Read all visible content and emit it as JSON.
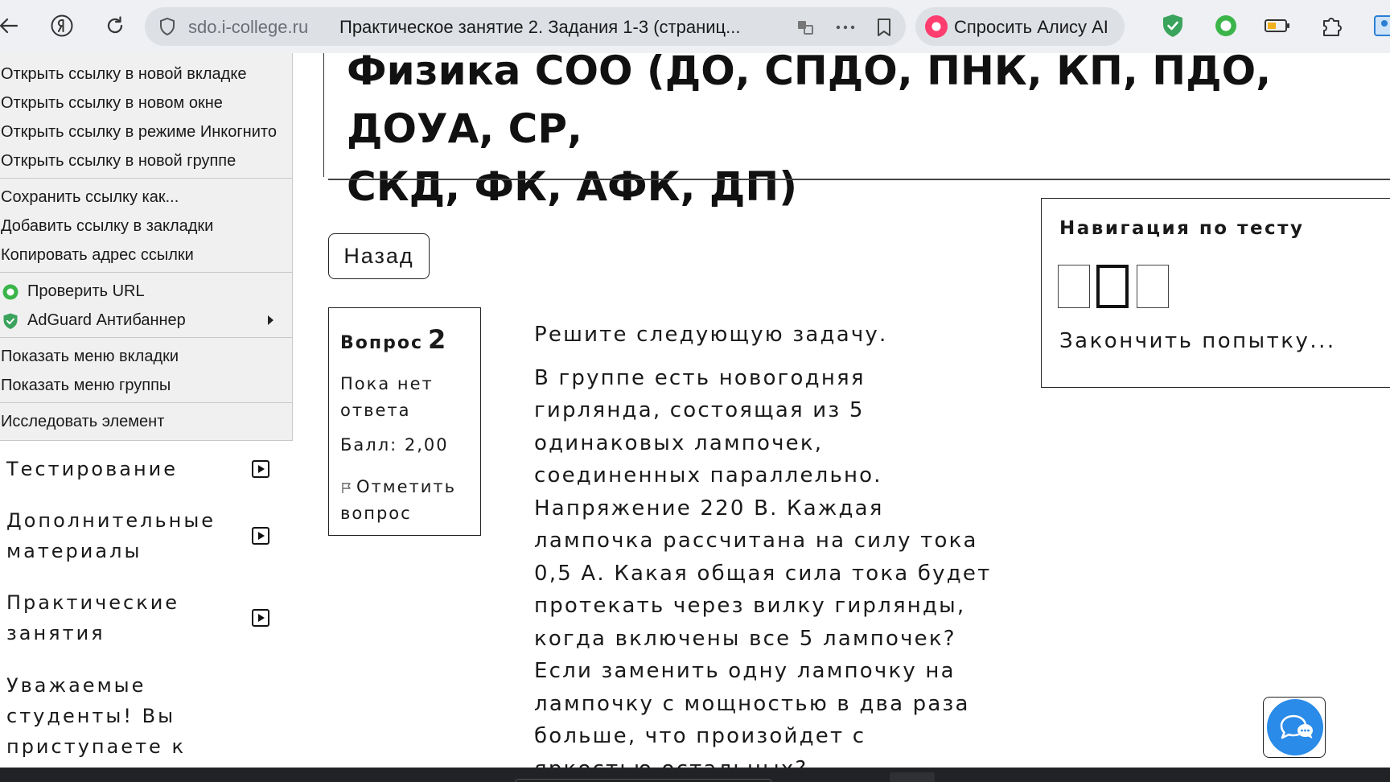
{
  "browser": {
    "domain": "sdo.i-college.ru",
    "tab_title": "Практическое занятие 2. Задания 1-3 (страниц...",
    "alice_label": "Спросить Алису AI"
  },
  "page": {
    "course_title": "Физика СОО (ДО, СПДО, ПНК, КП, ПДО, ДОУА, СР,\nСКД, ФК, АФК, ДП)",
    "back_label": "Назад"
  },
  "question_info": {
    "label": "Вопрос",
    "number": "2",
    "status": "Пока нет ответа",
    "score": "Балл: 2,00",
    "flag_label": "Отметить вопрос"
  },
  "question": {
    "intro": "Решите следующую задачу.",
    "text": "В группе есть новогодняя гирлянда, состоящая из 5 одинаковых лампочек, соединенных параллельно. Напряжение 220 В. Каждая лампочка рассчитана на силу тока 0,5 А. Какая общая сила тока будет протекать через вилку гирлянды, когда включены все 5 лампочек? Если  заменить одну лампочку на лампочку с мощностью в два раза больше, что произойдет с яркостью остальных?"
  },
  "quiz_nav": {
    "title": "Навигация по тесту",
    "current_index": 2,
    "finish_label": "Закончить попытку..."
  },
  "sidebar": {
    "items": [
      {
        "label": "Тестирование"
      },
      {
        "label": "Дополнительные материалы"
      },
      {
        "label": "Практические занятия"
      }
    ],
    "notice": "Уважаемые студенты! Вы приступаете к выполнению пр..."
  },
  "context_menu": {
    "items": [
      "Открыть ссылку в новой вкладке",
      "Открыть ссылку в новом окне",
      "Открыть ссылку в режиме Инкогнито",
      "Открыть ссылку в новой группе",
      "Сохранить ссылку как...",
      "Добавить ссылку в закладки",
      "Копировать адрес ссылки",
      "Проверить URL",
      "AdGuard Антибаннер",
      "Показать меню вкладки",
      "Показать меню группы",
      "Исследовать элемент"
    ]
  },
  "colors": {
    "toolbar_bg": "#eef0f3",
    "omnibox_bg": "#dde1e6",
    "alice_accent": "#ff3d6e",
    "adguard_green": "#3aa35c",
    "chat_blue": "#2a8be8",
    "menu_bg": "#f0f0f0"
  }
}
